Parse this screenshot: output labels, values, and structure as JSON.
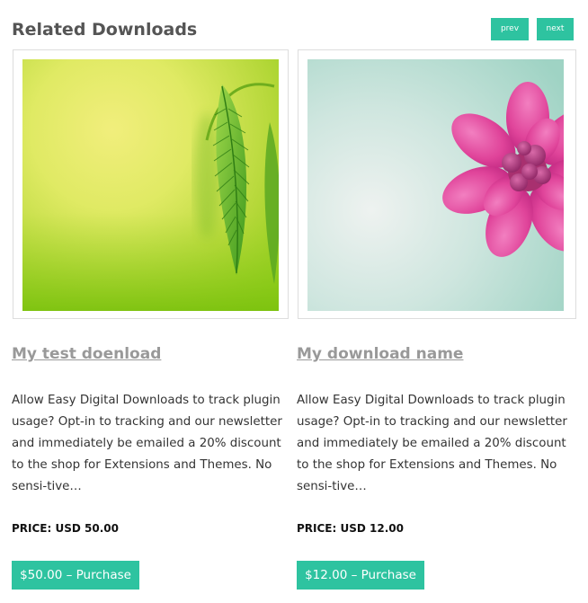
{
  "section": {
    "title": "Related Downloads"
  },
  "nav": {
    "prev_label": "prev",
    "next_label": "next"
  },
  "accent_color": "#2ec3a0",
  "downloads": [
    {
      "title": "My test doenload",
      "excerpt": "Allow Easy Digital Downloads to track plugin usage? Opt-in to tracking and our newsletter and immediately be emailed a 20% discount to the shop for Extensions and Themes. No sensi-tive…",
      "price": "PRICE: USD 50.00",
      "purchase_label": "$50.00 – Purchase",
      "thumbnail": "green-leaf-image"
    },
    {
      "title": "My download name",
      "excerpt": "Allow Easy Digital Downloads to track plugin usage? Opt-in to tracking and our newsletter and immediately be emailed a 20% discount to the shop for Extensions and Themes. No sensi-tive…",
      "price": "PRICE: USD 12.00",
      "purchase_label": "$12.00 – Purchase",
      "thumbnail": "pink-flower-image"
    }
  ]
}
